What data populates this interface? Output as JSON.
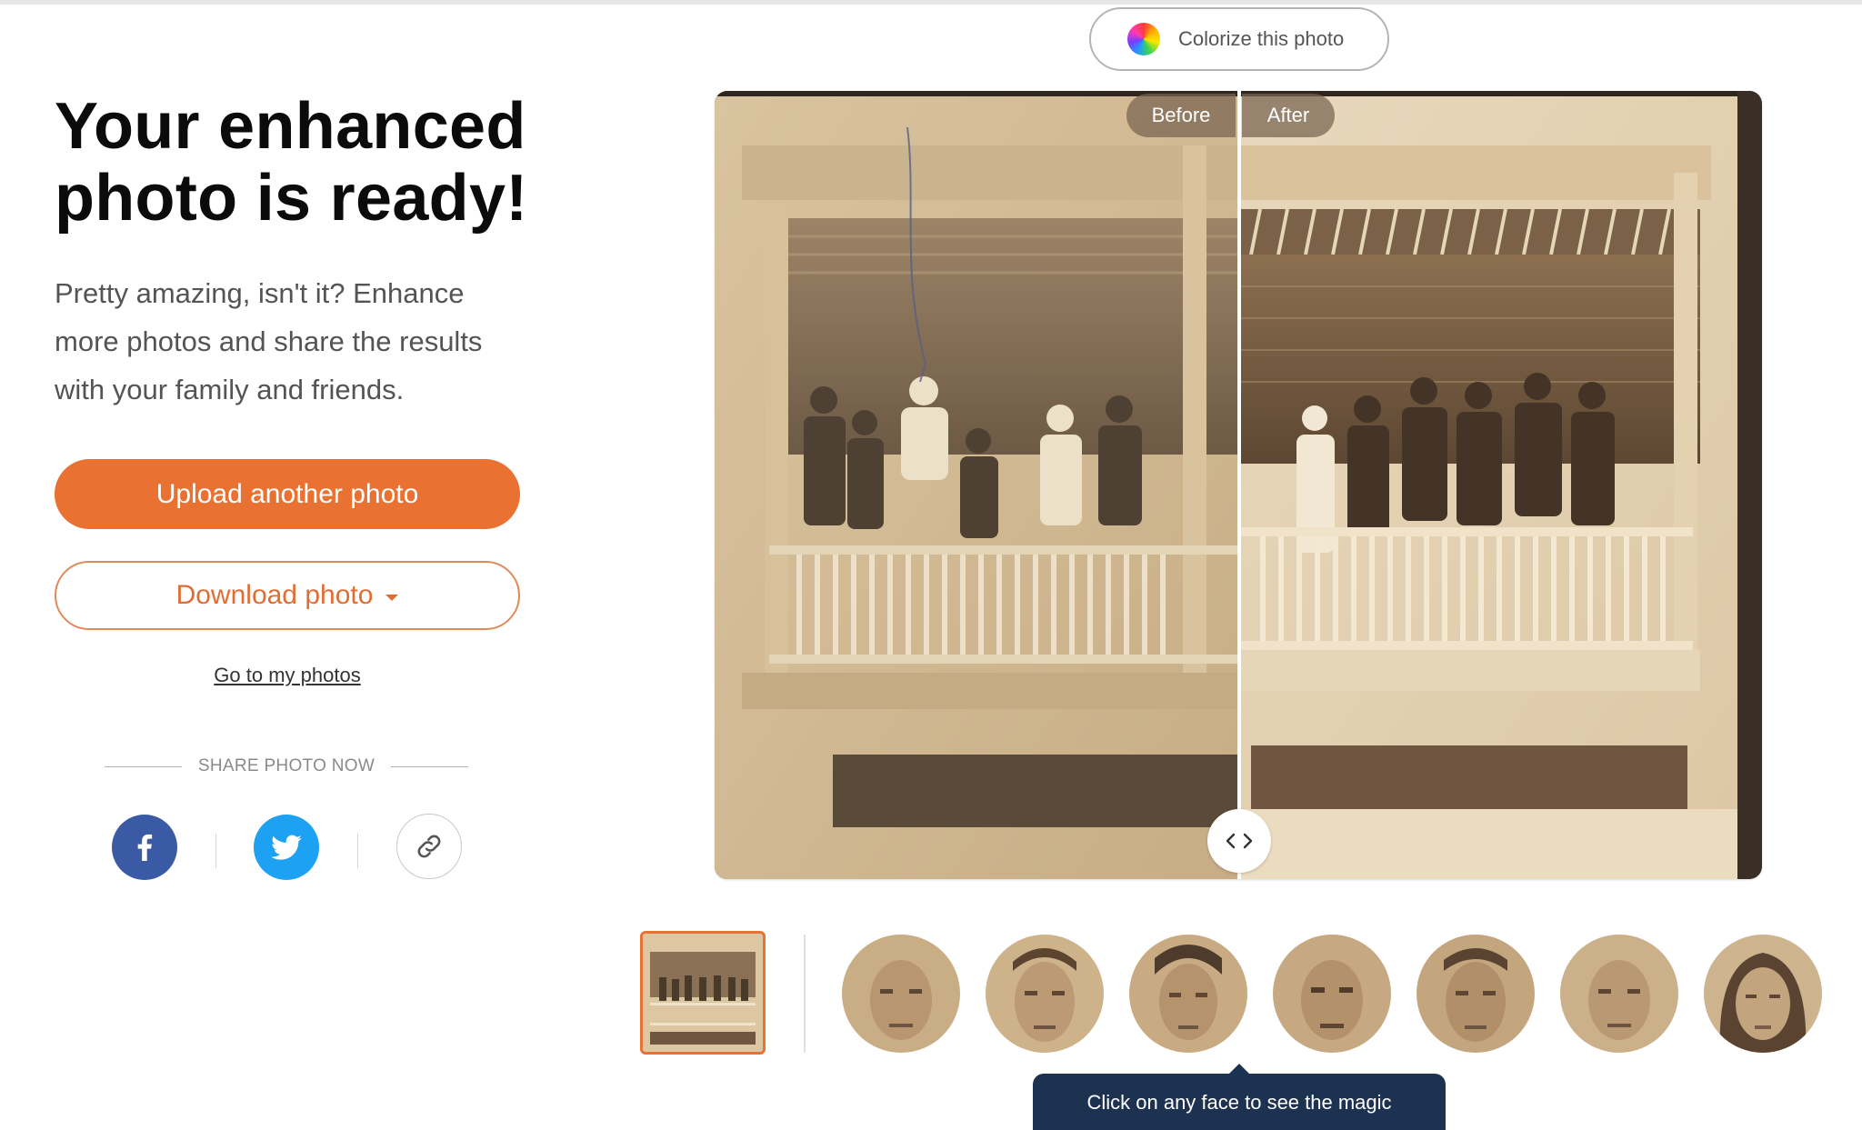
{
  "headline": {
    "line1": "Your enhanced",
    "line2": "photo is ready!"
  },
  "subtext": {
    "line1": "Pretty amazing, isn't it? Enhance",
    "line2": "more photos and share the results",
    "line3": "with your family and friends."
  },
  "actions": {
    "upload_label": "Upload another photo",
    "download_label": "Download photo",
    "my_photos_link": "Go to my photos"
  },
  "share": {
    "label": "SHARE PHOTO NOW",
    "buttons": [
      {
        "icon": "facebook-icon",
        "color": "#3b5aa6"
      },
      {
        "icon": "twitter-icon",
        "color": "#1da1f2"
      },
      {
        "icon": "link-icon",
        "color": "#ffffff"
      }
    ]
  },
  "colorize": {
    "label": "Colorize this photo",
    "icon": "color-wheel-icon"
  },
  "compare": {
    "before_label": "Before",
    "after_label": "After",
    "handle_icon": "chevrons-left-right-icon",
    "slider_position": 0.5
  },
  "thumbnails": {
    "faces_count": 7,
    "tooltip": "Click on any face to see the magic"
  },
  "colors": {
    "accent": "#e97131",
    "tooltip_bg": "#1d3150",
    "facebook": "#3b5aa6",
    "twitter": "#1da1f2"
  }
}
